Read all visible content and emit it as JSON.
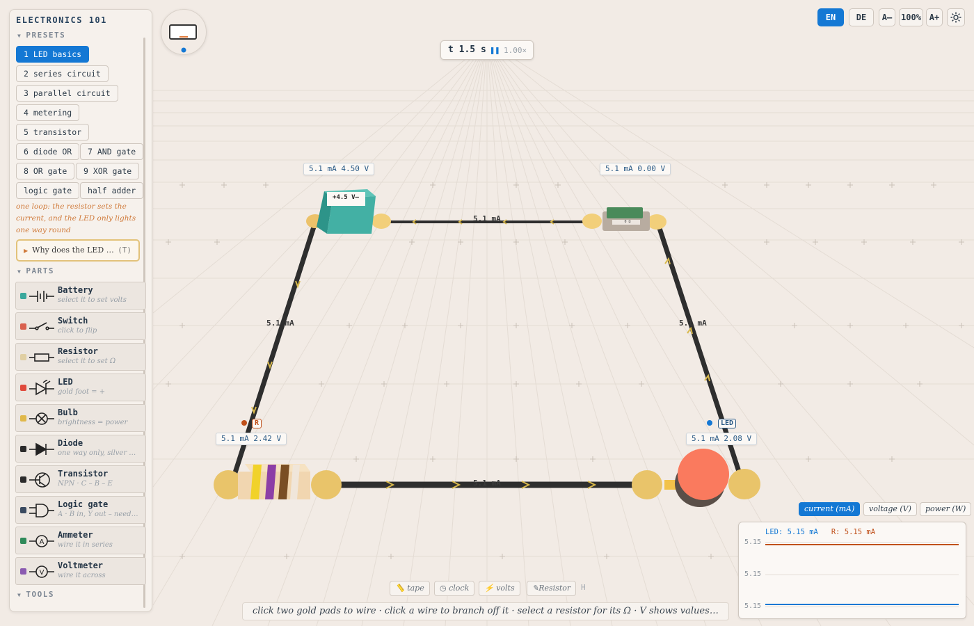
{
  "sidebar": {
    "title": "ELECTRONICS 101",
    "presets_heading": "PRESETS",
    "presets": [
      {
        "label": "1 LED basics",
        "active": true
      },
      {
        "label": "2 series circuit"
      },
      {
        "label": "3 parallel circuit"
      },
      {
        "label": "4 metering"
      },
      {
        "label": "5 transistor"
      },
      {
        "label": "6 diode OR"
      },
      {
        "label": "7 AND gate"
      },
      {
        "label": "8 OR gate"
      },
      {
        "label": "9 XOR gate"
      },
      {
        "label": "logic gate"
      },
      {
        "label": "half adder"
      }
    ],
    "hint": "one loop: the resistor sets the current, and the LED only lights one way round",
    "why_button": {
      "label": "Why does the LED …",
      "key": "(T)"
    },
    "parts_heading": "PARTS",
    "parts": [
      {
        "name": "Battery",
        "desc": "select it to set volts",
        "color": "#3aa89c",
        "icon": "battery-icon"
      },
      {
        "name": "Switch",
        "desc": "click to flip",
        "color": "#d9604e",
        "icon": "switch-icon"
      },
      {
        "name": "Resistor",
        "desc": "select it to set Ω",
        "color": "#e0cfa3",
        "icon": "resistor-icon"
      },
      {
        "name": "LED",
        "desc": "gold foot = +",
        "color": "#e04a3c",
        "icon": "led-icon"
      },
      {
        "name": "Bulb",
        "desc": "brightness = power",
        "color": "#e0b84a",
        "icon": "bulb-icon"
      },
      {
        "name": "Diode",
        "desc": "one way only, silver …",
        "color": "#2b2b2b",
        "icon": "diode-icon"
      },
      {
        "name": "Transistor",
        "desc": "NPN · C – B – E",
        "color": "#2b2b2b",
        "icon": "transistor-icon"
      },
      {
        "name": "Logic gate",
        "desc": "A · B in, Y out – need…",
        "color": "#3a4a60",
        "icon": "logic-gate-icon"
      },
      {
        "name": "Ammeter",
        "desc": "wire it in series",
        "color": "#2f8a5a",
        "icon": "ammeter-icon"
      },
      {
        "name": "Voltmeter",
        "desc": "wire it across",
        "color": "#8a5ab0",
        "icon": "voltmeter-icon"
      }
    ],
    "tools_heading": "TOOLS"
  },
  "time": {
    "value": "t 1.5 s",
    "pause_glyph": "❚❚",
    "speed": "1.00×"
  },
  "top_controls": {
    "lang_en": "EN",
    "lang_de": "DE",
    "font_minus": "A–",
    "zoom": "100%",
    "font_plus": "A+"
  },
  "canvas": {
    "battery_display": "+4.5 V–",
    "labels": {
      "battery": "5.1 mA   4.50 V",
      "switch": "5.1 mA   0.00 V",
      "resistor": "5.1 mA   2.42 V",
      "led": "5.1 mA   2.08 V"
    },
    "tags": {
      "resistor": "R",
      "led": "LED"
    },
    "switch_text": "0 Ω",
    "wire_currents": {
      "top": "5.1 mA",
      "left": "5.1 mA",
      "right": "5.1 mA",
      "bottom": "5.1 mA"
    }
  },
  "graph": {
    "tabs": [
      {
        "label": "current (mA)",
        "active": true
      },
      {
        "label": "voltage (V)"
      },
      {
        "label": "power (W)"
      }
    ],
    "legend_led": "LED: 5.15 mA",
    "legend_r": "R: 5.15 mA",
    "ticks": [
      "5.15",
      "5.15",
      "5.15"
    ],
    "colors": {
      "led": "#1478d4",
      "r": "#c0501a"
    }
  },
  "tools": [
    {
      "label": "tape",
      "icon": "ruler-icon"
    },
    {
      "label": "clock",
      "icon": "clock-icon"
    },
    {
      "label": "volts",
      "icon": "bolt-icon"
    },
    {
      "label": "Resistor",
      "icon": "pencil-icon"
    }
  ],
  "tools_key": "H",
  "status": "click two gold pads to wire · click a wire to branch off it · select a resistor for its Ω · V shows values · ri…"
}
